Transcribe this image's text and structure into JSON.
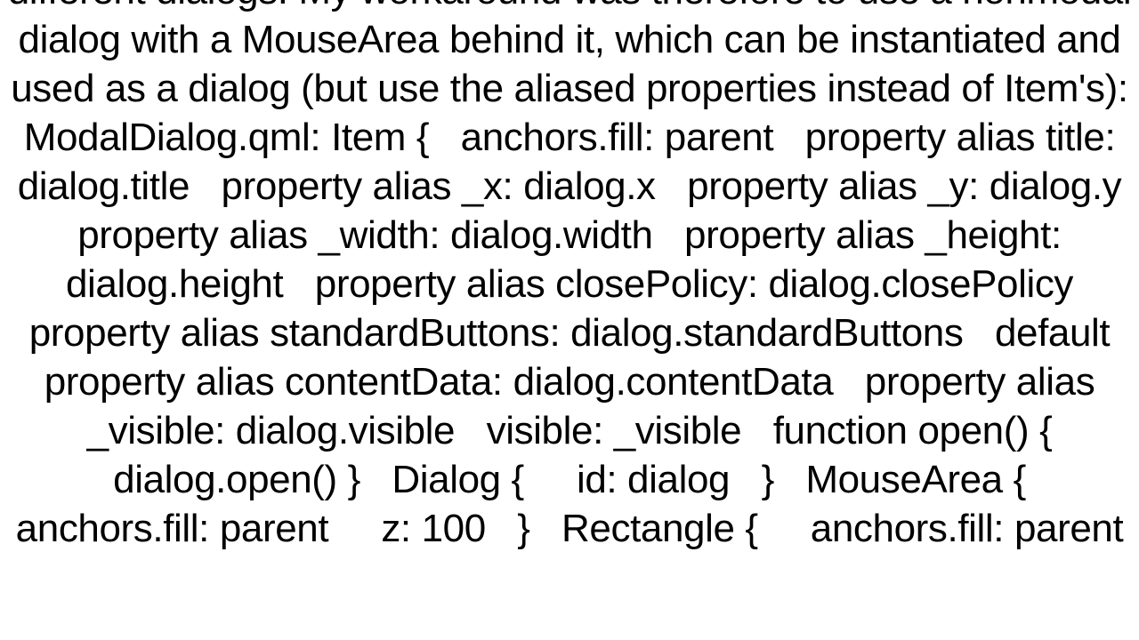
{
  "body_text": "different dialogs. My workaround was therefore to use a nonmodal dialog with a MouseArea behind it, which can be instantiated and used as a dialog (but use the aliased properties instead of Item's): ModalDialog.qml: Item {   anchors.fill: parent   property alias title: dialog.title   property alias _x: dialog.x   property alias _y: dialog.y   property alias _width: dialog.width   property alias _height: dialog.height   property alias closePolicy: dialog.closePolicy   property alias standardButtons: dialog.standardButtons   default property alias contentData: dialog.contentData   property alias _visible: dialog.visible   visible: _visible   function open() { dialog.open() }   Dialog {     id: dialog   }   MouseArea {     anchors.fill: parent     z: 100   }   Rectangle {     anchors.fill: parent"
}
